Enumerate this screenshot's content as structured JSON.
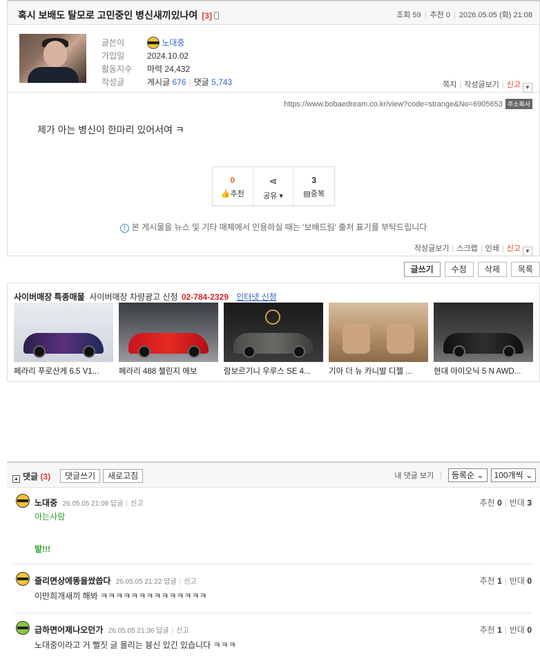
{
  "post": {
    "title": "혹시 보배도 탈모로 고민중인 병신새끼있나여",
    "comment_count": "[3]",
    "views_label": "조회",
    "views": "59",
    "likes_label": "추천",
    "likes": "0",
    "datetime": "2026.05.05 (화) 21:08"
  },
  "author": {
    "labels": [
      "글쓴이",
      "가입일",
      "활동지수",
      "작성글"
    ],
    "nickname": "노대중",
    "joined": "2024.10.02",
    "activity": "마력 24,432",
    "posts_label": "게시글",
    "posts": "676",
    "replies_label": "댓글",
    "replies": "5,743",
    "links": [
      "쪽지",
      "작성글보기"
    ],
    "report": "신고"
  },
  "url": "https://www.bobaedream.co.kr/view?code=strange&No=6905653",
  "url_badge": "주소복사",
  "content": "제가 아는 병신이 한마리 있어서여 ㅋ",
  "votes": {
    "recommend_count": "0",
    "recommend_label": "추천",
    "share_label": "공유",
    "dup_count": "3",
    "dup_label": "중복"
  },
  "notice": "본 게시물을 뉴스 및 기타 매체에서 인용하실 때는 '보배드림' 출처 표기를 부탁드립니다",
  "bottom_links": [
    "작성글보기",
    "스크랩",
    "인쇄"
  ],
  "bottom_report": "신고",
  "actions": [
    "글쓰기",
    "수정",
    "삭제",
    "목록"
  ],
  "ads": {
    "title": "사이버매장 특종매물",
    "sub": "사이버매장 차량광고 신청",
    "tel": "02-784-2329",
    "apply": "인터넷 신청",
    "items": [
      {
        "caption": "페라리 푸로산게 6.5 V1..."
      },
      {
        "caption": "페라리 488 챌린지 에보"
      },
      {
        "caption": "람보르기니 우루스 SE 4..."
      },
      {
        "caption": "기아 더 뉴 카니발 디젤 ..."
      },
      {
        "caption": "현대 아이오닉 5 N AWD..."
      }
    ]
  },
  "comments": {
    "title": "댓글",
    "count": "(3)",
    "write_btn": "댓글쓰기",
    "refresh_btn": "새로고침",
    "my_comments": "내 댓글 보기",
    "sort": "등록순",
    "per_page": "100개씩",
    "items": [
      {
        "name": "노대중",
        "date": "26.05.05 21:09",
        "reply": "답글",
        "report": "신고",
        "up_label": "추천",
        "up": "0",
        "down_label": "반대",
        "down": "3",
        "text1": "아는사람",
        "text2": "발!!!"
      },
      {
        "name": "줄리면상에똥을쌌씁다",
        "date": "26.05.05 21:22",
        "reply": "답글",
        "report": "신고",
        "up_label": "추천",
        "up": "1",
        "down_label": "반대",
        "down": "0",
        "text1": "이만희개새끼 해봐 ㅋㅋㅋㅋㅋㅋㅋㅋㅋㅋㅋㅋㅋㅋ"
      },
      {
        "name": "급하면어제나오던가",
        "date": "26.05.05 21:36",
        "reply": "답글",
        "report": "신고",
        "up_label": "추천",
        "up": "1",
        "down_label": "반대",
        "down": "0",
        "text1": "노대중이라고 거 뻘짓 글 올리는 븅신 있긴 있습니다 ㅋㅋㅋ"
      }
    ]
  }
}
